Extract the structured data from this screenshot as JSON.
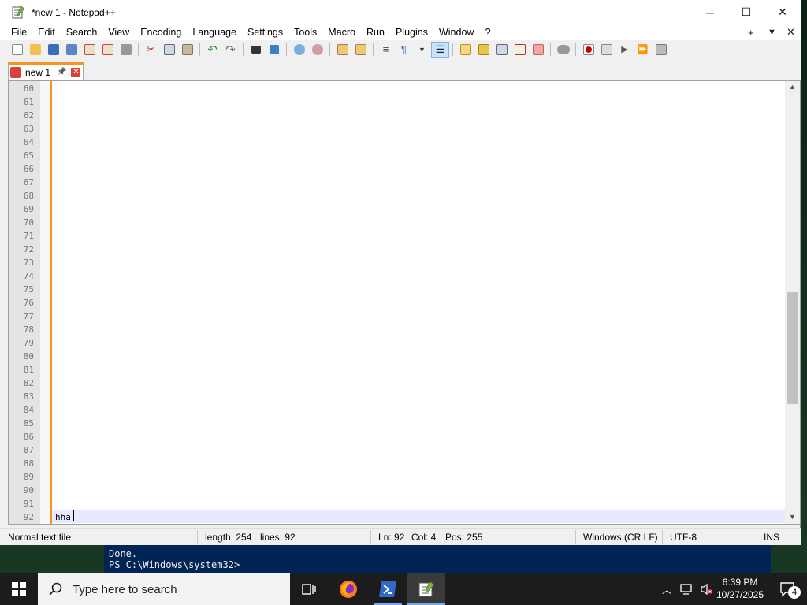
{
  "window": {
    "title": "*new 1 - Notepad++",
    "controls": {
      "minimize": "─",
      "maximize": "☐",
      "close": "✕"
    }
  },
  "menubar": {
    "items": [
      "File",
      "Edit",
      "Search",
      "View",
      "Encoding",
      "Language",
      "Settings",
      "Tools",
      "Macro",
      "Run",
      "Plugins",
      "Window",
      "?"
    ],
    "right": {
      "add": "+",
      "dropdown": "▼",
      "close": "✕"
    }
  },
  "tab": {
    "label": "new 1",
    "pin": "📌",
    "close": "✕"
  },
  "editor": {
    "line_numbers": [
      "60",
      "61",
      "62",
      "63",
      "64",
      "65",
      "66",
      "67",
      "68",
      "69",
      "70",
      "71",
      "72",
      "73",
      "74",
      "75",
      "76",
      "77",
      "78",
      "79",
      "80",
      "81",
      "82",
      "83",
      "84",
      "85",
      "86",
      "87",
      "88",
      "89",
      "90",
      "91",
      "92"
    ],
    "current_line_text": "hha"
  },
  "statusbar": {
    "file_type": "Normal text file",
    "length": "length: 254",
    "lines": "lines: 92",
    "ln": "Ln: 92",
    "col": "Col: 4",
    "pos": "Pos: 255",
    "eol": "Windows (CR LF)",
    "encoding": "UTF-8",
    "mode": "INS"
  },
  "powershell": {
    "line1": "Done.",
    "line2": "PS C:\\Windows\\system32>"
  },
  "taskbar": {
    "search_placeholder": "Type here to search",
    "time": "6:39 PM",
    "date": "10/27/2025",
    "notifications": "4"
  },
  "colors": {
    "accent_orange": "#f79421",
    "current_line": "#e8e8ff",
    "powershell_bg": "#012456",
    "taskbar_bg": "#1c1c1c"
  },
  "toolbar_icons": [
    "new-file-icon",
    "open-file-icon",
    "save-icon",
    "save-all-icon",
    "close-icon",
    "close-all-icon",
    "print-icon",
    "cut-icon",
    "copy-icon",
    "paste-icon",
    "undo-icon",
    "redo-icon",
    "find-icon",
    "replace-icon",
    "zoom-in-icon",
    "zoom-out-icon",
    "sync-v-icon",
    "sync-h-icon",
    "word-wrap-icon",
    "show-all-chars-icon",
    "indent-guide-icon",
    "udl-icon",
    "doc-map-icon",
    "func-list-icon",
    "folder-workspace-icon",
    "monitor-icon",
    "record-icon",
    "stop-icon",
    "play-icon",
    "run-multiple-icon",
    "save-macro-icon"
  ]
}
